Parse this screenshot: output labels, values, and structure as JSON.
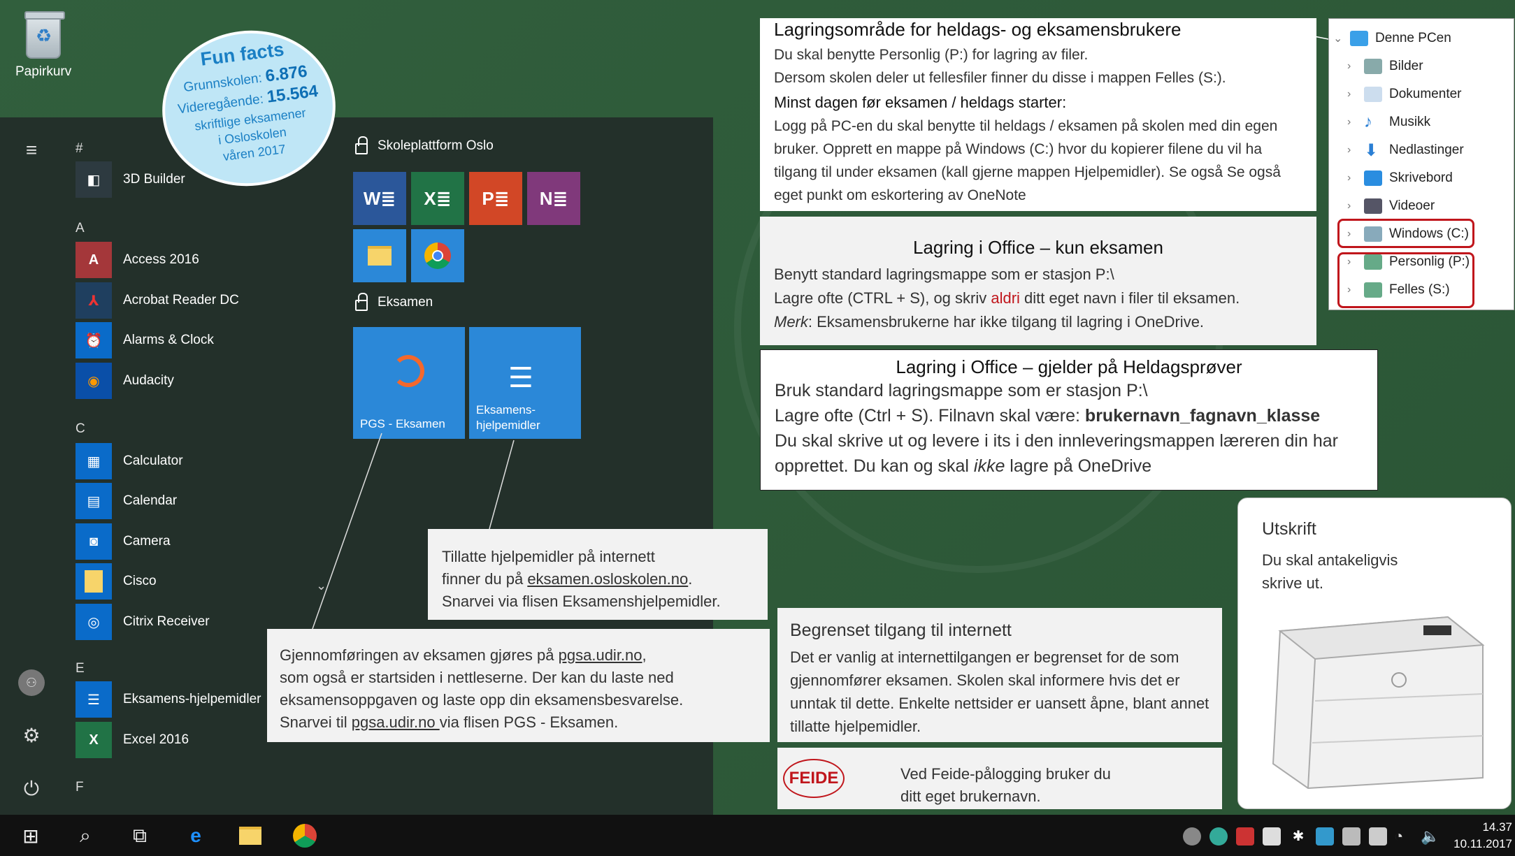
{
  "desktop": {
    "recycle_bin_label": "Papirkurv"
  },
  "fun_facts": {
    "title": "Fun facts",
    "line1_label": "Grunnskolen:",
    "line1_value": "6.876",
    "line2_label": "Videregående:",
    "line2_value": "15.564",
    "line3": "skriftlige eksamener",
    "line4": "i Osloskolen",
    "line5": "våren 2017"
  },
  "start_menu": {
    "letters": [
      "#",
      "A",
      "C",
      "E",
      "F"
    ],
    "apps": [
      {
        "name": "3D Builder",
        "icon": "3d-builder-icon",
        "color": "#2d3a40"
      },
      {
        "name": "Access 2016",
        "icon": "access-icon",
        "color": "#a4373a"
      },
      {
        "name": "Acrobat Reader DC",
        "icon": "acrobat-icon",
        "color": "#1f3f5f"
      },
      {
        "name": "Alarms & Clock",
        "icon": "alarm-clock-icon",
        "color": "#0a6bc9"
      },
      {
        "name": "Audacity",
        "icon": "audacity-icon",
        "color": "#0a4fa8"
      },
      {
        "name": "Calculator",
        "icon": "calculator-icon",
        "color": "#0a6bc9"
      },
      {
        "name": "Calendar",
        "icon": "calendar-icon",
        "color": "#0a6bc9"
      },
      {
        "name": "Camera",
        "icon": "camera-icon",
        "color": "#0a6bc9"
      },
      {
        "name": "Cisco",
        "icon": "folder-icon",
        "color": "#0a6bc9"
      },
      {
        "name": "Citrix Receiver",
        "icon": "citrix-icon",
        "color": "#0a6bc9"
      },
      {
        "name": "Eksamens-hjelpemidler",
        "icon": "books-icon",
        "color": "#0a6bc9"
      },
      {
        "name": "Excel 2016",
        "icon": "excel-icon",
        "color": "#217346"
      }
    ],
    "group1": "Skoleplattform Oslo",
    "group2": "Eksamen",
    "tile_pgs": "PGS - Eksamen",
    "tile_hjelp_1": "Eksamens-",
    "tile_hjelp_2": "hjelpemidler"
  },
  "box_storage": {
    "title": "Lagringsområde for heldags- og eksamensbrukere",
    "p1": "Du skal benytte Personlig (P:) for lagring av filer.",
    "p2": "Dersom skolen deler ut fellesfiler finner du disse i mappen Felles (S:).",
    "subtitle": "Minst dagen før eksamen / heldags starter:",
    "p3": "Logg på PC-en du skal benytte til heldags / eksamen på skolen med din egen bruker. Opprett en mappe på Windows (C:) hvor du kopierer filene du vil ha tilgang til under eksamen (kall gjerne mappen Hjelpemidler). Se også Se også eget punkt om eskortering av OneNote"
  },
  "box_office_exam": {
    "title": "Lagring i Office – kun eksamen",
    "p1": "Benytt standard lagringsmappe som er stasjon P:\\",
    "p2a": "Lagre ofte (CTRL + S), og skriv ",
    "p2b": "aldri",
    "p2c": " ditt eget navn i filer til eksamen.",
    "p3a": "Merk",
    "p3b": ": Eksamensbrukerne har ikke tilgang til lagring i OneDrive.",
    "accent": "#c0161c"
  },
  "box_office_day": {
    "title": "Lagring i Office – gjelder på Heldagsprøver",
    "p1": "Bruk standard lagringsmappe som er stasjon P:\\",
    "p2a": "Lagre ofte (Ctrl + S). Filnavn skal være: ",
    "p2b": "brukernavn_fagnavn_klasse",
    "p3": "Du skal skrive ut og levere i its i den innleveringsmappen læreren din har opprettet. Du kan og skal ",
    "p3i": "ikke",
    "p3c": " lagre på OneDrive"
  },
  "box_aids": {
    "l1": "Tillatte hjelpemidler på internett",
    "l2a": "finner du på ",
    "l2b": "eksamen.osloskolen.no",
    "l2c": ".",
    "l3": "Snarvei via flisen Eksamenshjelpemidler."
  },
  "box_pgs": {
    "l1a": "Gjennomføringen av eksamen gjøres på ",
    "l1b": "pgsa.udir.no",
    "l1c": ",",
    "l2": "som også er startsiden i nettleserne. Der kan du laste ned",
    "l3": "eksamensoppgaven og laste opp din eksamensbesvarelse.",
    "l4a": "Snarvei til ",
    "l4b": "pgsa.udir.no ",
    "l4c": "via flisen PGS - Eksamen."
  },
  "box_internet": {
    "title": "Begrenset tilgang til internett",
    "text": "Det er vanlig at internettilgangen er begrenset for de som gjennomfører eksamen. Skolen skal informere hvis det er unntak til dette. Enkelte nettsider er uansett åpne, blant annet tillatte hjelpemidler."
  },
  "box_feide": {
    "logo": "FEIDE",
    "l1": "Ved Feide-pålogging bruker du",
    "l2": "ditt eget brukernavn."
  },
  "box_print": {
    "title": "Utskrift",
    "l1": "Du skal antakeligvis",
    "l2": "skrive ut."
  },
  "explorer": {
    "root": "Denne PCen",
    "items": [
      "Bilder",
      "Dokumenter",
      "Musikk",
      "Nedlastinger",
      "Skrivebord",
      "Videoer",
      "Windows (C:)",
      "Personlig (P:)",
      "Felles (S:)"
    ]
  },
  "taskbar": {
    "time": "14.37",
    "date": "10.11.2017"
  }
}
